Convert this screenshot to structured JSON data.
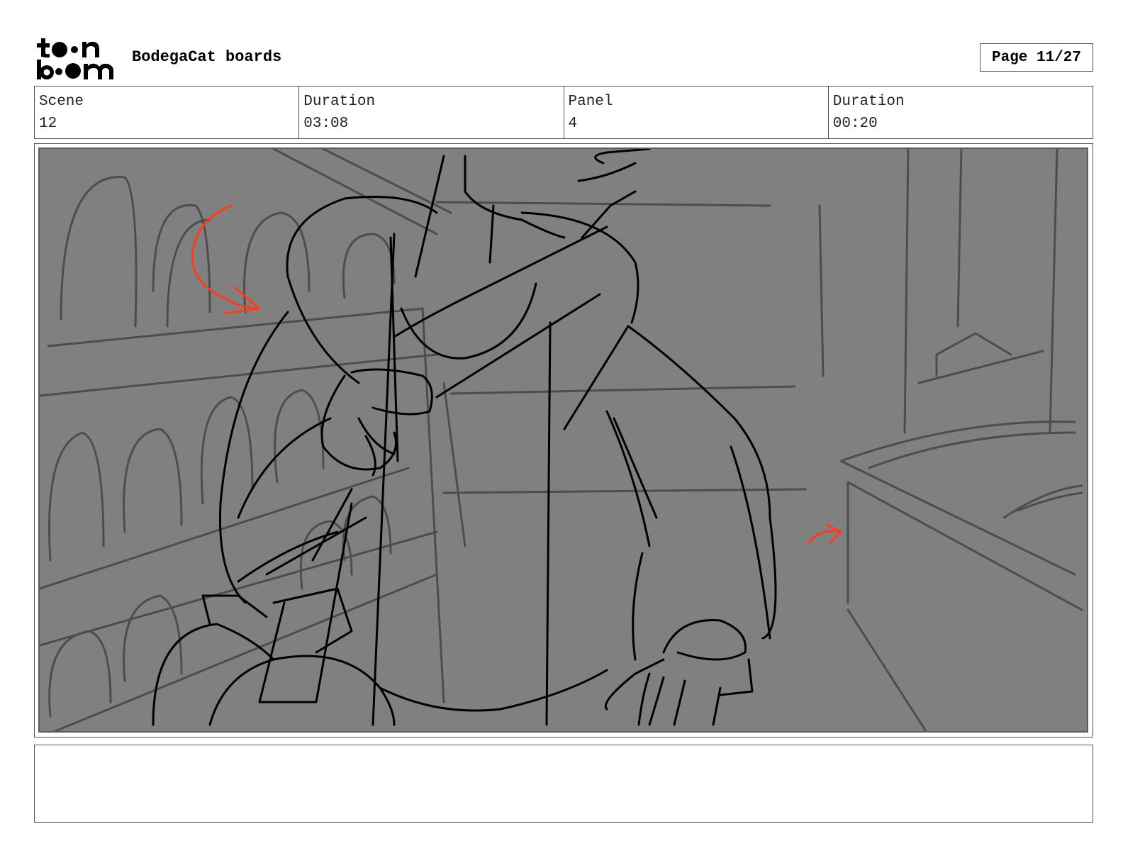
{
  "header": {
    "logo_text": "toon boom",
    "project_title": "BodegaCat boards",
    "page_label": "Page 11/27"
  },
  "info": {
    "scene_label": "Scene",
    "scene_value": "12",
    "scene_duration_label": "Duration",
    "scene_duration_value": "03:08",
    "panel_label": "Panel",
    "panel_value": "4",
    "panel_duration_label": "Duration",
    "panel_duration_value": "00:20"
  },
  "panel": {
    "background_color": "#808080",
    "sketch_color": "#000000",
    "set_color": "#4d4d4d",
    "arrow_color": "#ff3b1a"
  },
  "notes": {
    "text": ""
  }
}
